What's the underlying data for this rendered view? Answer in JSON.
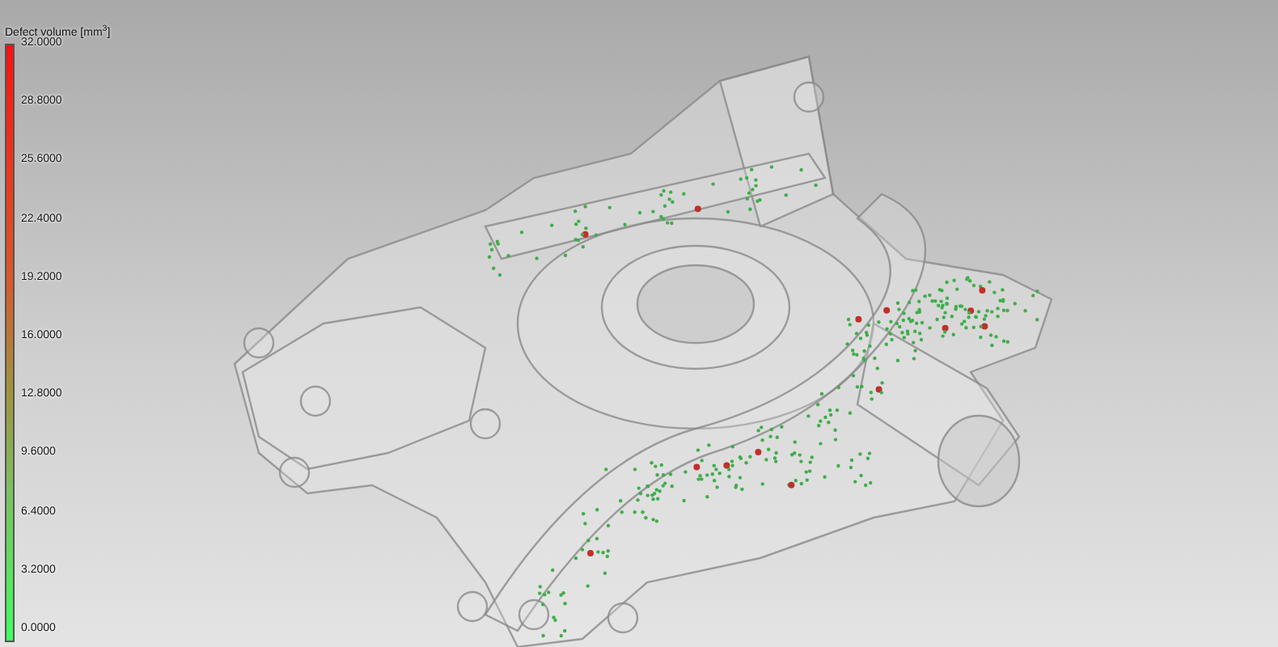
{
  "legend": {
    "title": "Defect volume [mm$^{3}$]",
    "ticks": [
      "32.0000",
      "28.8000",
      "25.6000",
      "22.4000",
      "19.2000",
      "16.0000",
      "12.8000",
      "9.6000",
      "6.4000",
      "3.2000",
      "0.0000"
    ]
  }
}
